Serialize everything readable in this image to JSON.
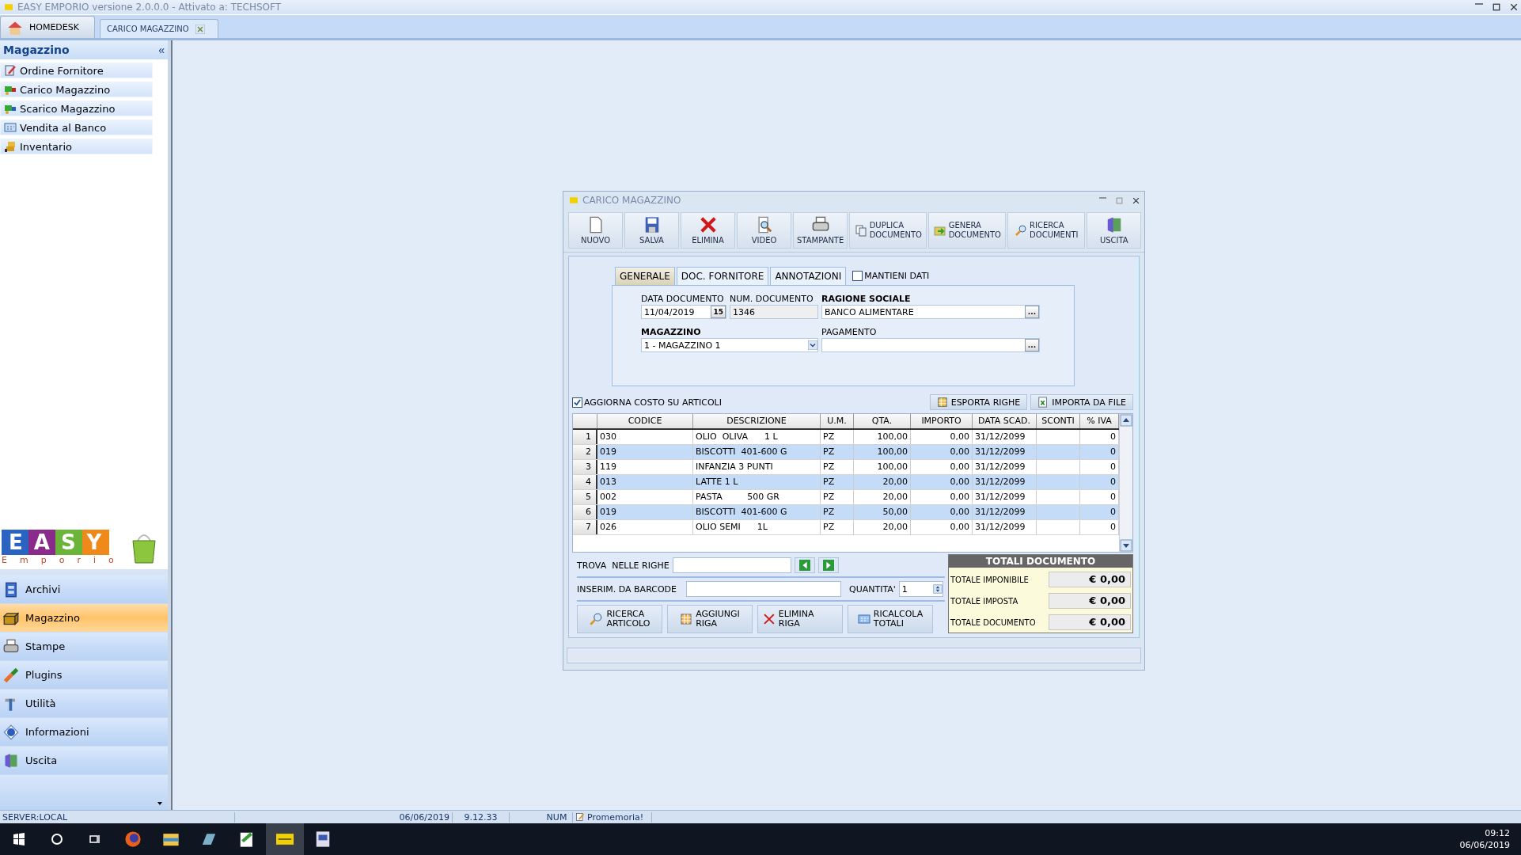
{
  "window": {
    "title": "EASY EMPORIO versione 2.0.0.0 - Attivato a: TECHSOFT"
  },
  "doc_tabs": [
    {
      "label": "HOMEDESK",
      "selected": false
    },
    {
      "label": "CARICO MAGAZZINO",
      "selected": true
    }
  ],
  "sidebar": {
    "title": "Magazzino",
    "collapse": "«",
    "items": [
      {
        "label": "Ordine Fornitore",
        "selected": false
      },
      {
        "label": "Carico Magazzino",
        "selected": false
      },
      {
        "label": "Scarico Magazzino",
        "selected": false
      },
      {
        "label": "Vendita al Banco",
        "selected": false
      },
      {
        "label": "Inventario",
        "selected": false
      }
    ],
    "logo": {
      "word": "EASY",
      "sub": "Emporio"
    },
    "nav": [
      {
        "label": "Archivi",
        "selected": false
      },
      {
        "label": "Magazzino",
        "selected": true
      },
      {
        "label": "Stampe",
        "selected": false
      },
      {
        "label": "Plugins",
        "selected": false
      },
      {
        "label": "Utilità",
        "selected": false
      },
      {
        "label": "Informazioni",
        "selected": false
      },
      {
        "label": "Uscita",
        "selected": false
      }
    ]
  },
  "dialog": {
    "title": "CARICO MAGAZZINO",
    "toolbar": [
      {
        "kind": "stacked",
        "lines": [
          "NUOVO"
        ]
      },
      {
        "kind": "stacked",
        "lines": [
          "SALVA"
        ]
      },
      {
        "kind": "stacked",
        "lines": [
          "ELIMINA"
        ]
      },
      {
        "kind": "stacked",
        "lines": [
          "VIDEO"
        ]
      },
      {
        "kind": "stacked",
        "lines": [
          "STAMPANTE"
        ]
      },
      {
        "kind": "inline",
        "lines": [
          "DUPLICA",
          "DOCUMENTO"
        ]
      },
      {
        "kind": "inline",
        "lines": [
          "GENERA",
          "DOCUMENTO"
        ]
      },
      {
        "kind": "inline",
        "lines": [
          "RICERCA",
          "DOCUMENTI"
        ]
      },
      {
        "kind": "stacked",
        "lines": [
          "USCITA"
        ]
      }
    ],
    "tabs": [
      {
        "label": "GENERALE",
        "selected": true
      },
      {
        "label": "DOC. FORNITORE",
        "selected": false
      },
      {
        "label": "ANNOTAZIONI",
        "selected": false
      }
    ],
    "keep_data": {
      "label": "MANTIENI DATI",
      "checked": false
    },
    "form": {
      "date_label": "DATA DOCUMENTO",
      "date_value": "11/04/2019",
      "date_button": "15",
      "num_label": "NUM. DOCUMENTO",
      "num_value": "1346",
      "company_label": "RAGIONE SOCIALE",
      "company_value": "BANCO ALIMENTARE",
      "company_button": "...",
      "warehouse_label": "MAGAZZINO",
      "warehouse_value": "1 - MAGAZZINO 1",
      "payment_label": "PAGAMENTO",
      "payment_button": "..."
    },
    "update_cost": {
      "label": "AGGIORNA COSTO SU ARTICOLI",
      "checked": true
    },
    "row_actions": [
      "ESPORTA RIGHE",
      "IMPORTA DA FILE"
    ],
    "table": {
      "columns": [
        "CODICE",
        "DESCRIZIONE",
        "U.M.",
        "QTA.",
        "IMPORTO",
        "DATA SCAD.",
        "SCONTI",
        "% IVA"
      ],
      "rows": [
        {
          "num": "1",
          "cells": [
            "030",
            "OLIO  OLIVA      1 L",
            "PZ",
            "100,00",
            "0,00",
            "31/12/2099",
            "",
            "0"
          ]
        },
        {
          "num": "2",
          "cells": [
            "019",
            "BISCOTTI  401-600 G",
            "PZ",
            "100,00",
            "0,00",
            "31/12/2099",
            "",
            "0"
          ]
        },
        {
          "num": "3",
          "cells": [
            "119",
            "INFANZIA 3 PUNTI",
            "PZ",
            "100,00",
            "0,00",
            "31/12/2099",
            "",
            "0"
          ]
        },
        {
          "num": "4",
          "cells": [
            "013",
            "LATTE 1 L",
            "PZ",
            "20,00",
            "0,00",
            "31/12/2099",
            "",
            "0"
          ]
        },
        {
          "num": "5",
          "cells": [
            "002",
            "PASTA         500 GR",
            "PZ",
            "20,00",
            "0,00",
            "31/12/2099",
            "",
            "0"
          ]
        },
        {
          "num": "6",
          "cells": [
            "019",
            "BISCOTTI  401-600 G",
            "PZ",
            "50,00",
            "0,00",
            "31/12/2099",
            "",
            "0"
          ]
        },
        {
          "num": "7",
          "cells": [
            "026",
            "OLIO SEMI      1L",
            "PZ",
            "20,00",
            "0,00",
            "31/12/2099",
            "",
            "0"
          ]
        }
      ]
    },
    "find_label": "TROVA  NELLE RIGHE",
    "barcode_label": "INSERIM. DA BARCODE",
    "qty_label": "QUANTITA'",
    "qty_value": "1",
    "actions": [
      [
        "RICERCA",
        "ARTICOLO"
      ],
      [
        "AGGIUNGI",
        "RIGA"
      ],
      [
        "ELIMINA RIGA"
      ],
      [
        "RICALCOLA",
        "TOTALI"
      ]
    ],
    "totals": {
      "title": "TOTALI DOCUMENTO",
      "rows": [
        {
          "label": "TOTALE IMPONIBILE",
          "value": "€ 0,00"
        },
        {
          "label": "TOTALE IMPOSTA",
          "value": "€ 0,00"
        },
        {
          "label": "TOTALE DOCUMENTO",
          "value": "€ 0,00"
        }
      ]
    }
  },
  "status_bar": {
    "server": "SERVER:LOCAL",
    "date": "06/06/2019",
    "time": "9.12.33",
    "num": "NUM",
    "memo": "Promemoria!"
  },
  "taskbar": {
    "time": "09:12",
    "date": "06/06/2019"
  }
}
